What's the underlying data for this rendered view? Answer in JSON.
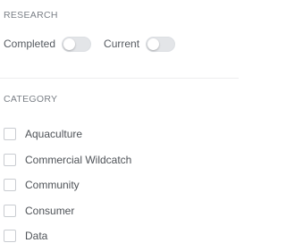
{
  "research": {
    "heading": "RESEARCH",
    "toggles": [
      {
        "label": "Completed",
        "on": false
      },
      {
        "label": "Current",
        "on": false
      }
    ]
  },
  "category": {
    "heading": "CATEGORY",
    "items": [
      {
        "label": "Aquaculture",
        "checked": false
      },
      {
        "label": "Commercial Wildcatch",
        "checked": false
      },
      {
        "label": "Community",
        "checked": false
      },
      {
        "label": "Consumer",
        "checked": false
      },
      {
        "label": "Data",
        "checked": false
      }
    ]
  },
  "colors": {
    "toggle_off": "#e3e5e8",
    "heading_text": "#7a7f86",
    "label_text": "#555a60",
    "checkbox_border": "#c9ccd1"
  }
}
